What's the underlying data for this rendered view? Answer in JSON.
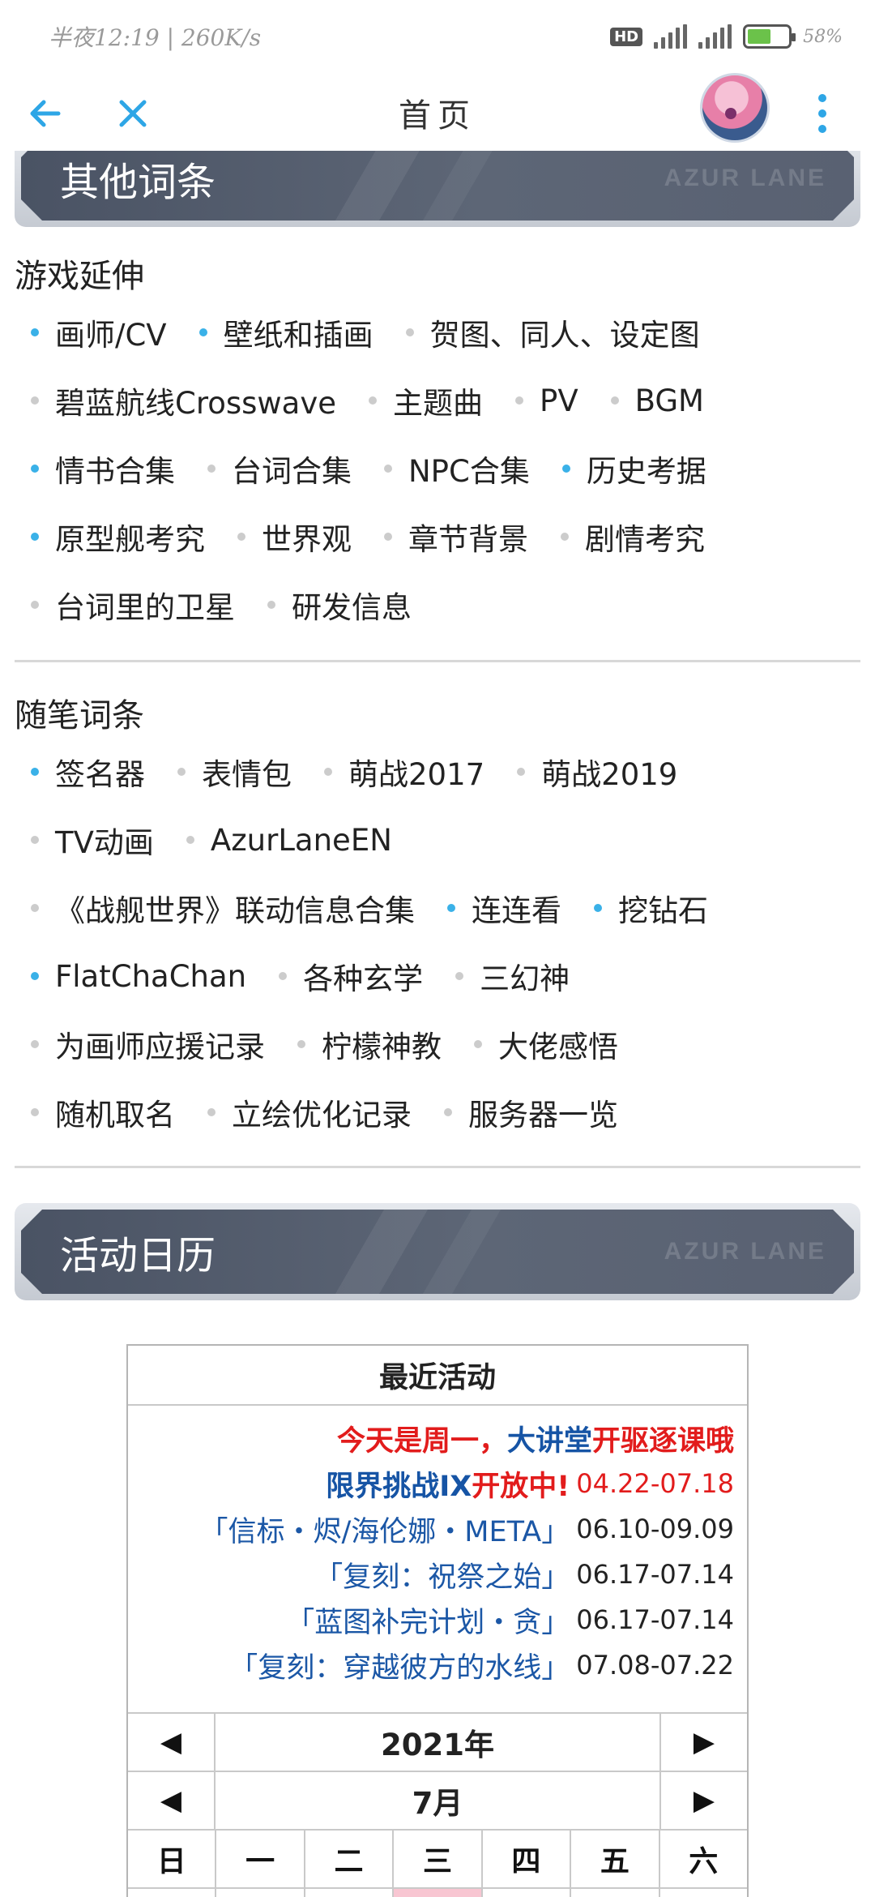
{
  "status_bar": {
    "left_text": "半夜12:19 | 260K/s",
    "hd_badge": "HD",
    "battery_percent": "58%"
  },
  "app_bar": {
    "title": "首页"
  },
  "banners": {
    "other_entries": "其他词条",
    "activity_calendar": "活动日历",
    "logo_text": "AZUR LANE"
  },
  "game_extension": {
    "heading": "游戏延伸",
    "rows": [
      [
        {
          "label": "画师/CV",
          "bullet": "blue"
        },
        {
          "label": "壁纸和插画",
          "bullet": "blue"
        },
        {
          "label": "贺图、同人、设定图",
          "bullet": "grey"
        }
      ],
      [
        {
          "label": "碧蓝航线Crosswave",
          "bullet": "grey"
        },
        {
          "label": "主题曲",
          "bullet": "grey"
        },
        {
          "label": "PV",
          "bullet": "grey"
        },
        {
          "label": "BGM",
          "bullet": "grey"
        }
      ],
      [
        {
          "label": "情书合集",
          "bullet": "blue"
        },
        {
          "label": "台词合集",
          "bullet": "grey"
        },
        {
          "label": "NPC合集",
          "bullet": "grey"
        },
        {
          "label": "历史考据",
          "bullet": "blue"
        }
      ],
      [
        {
          "label": "原型舰考究",
          "bullet": "blue"
        },
        {
          "label": "世界观",
          "bullet": "grey"
        },
        {
          "label": "章节背景",
          "bullet": "grey"
        },
        {
          "label": "剧情考究",
          "bullet": "grey"
        }
      ],
      [
        {
          "label": "台词里的卫星",
          "bullet": "grey"
        },
        {
          "label": "研发信息",
          "bullet": "grey"
        }
      ]
    ]
  },
  "essay_entries": {
    "heading": "随笔词条",
    "rows": [
      [
        {
          "label": "签名器",
          "bullet": "blue"
        },
        {
          "label": "表情包",
          "bullet": "grey"
        },
        {
          "label": "萌战2017",
          "bullet": "grey"
        },
        {
          "label": "萌战2019",
          "bullet": "grey"
        }
      ],
      [
        {
          "label": "TV动画",
          "bullet": "grey"
        },
        {
          "label": "AzurLaneEN",
          "bullet": "grey"
        }
      ],
      [
        {
          "label": "《战舰世界》联动信息合集",
          "bullet": "grey"
        },
        {
          "label": "连连看",
          "bullet": "blue"
        },
        {
          "label": "挖钻石",
          "bullet": "blue"
        }
      ],
      [
        {
          "label": "FlatChaChan",
          "bullet": "blue"
        },
        {
          "label": "各种玄学",
          "bullet": "grey"
        },
        {
          "label": "三幻神",
          "bullet": "grey"
        }
      ],
      [
        {
          "label": "为画师应援记录",
          "bullet": "grey"
        },
        {
          "label": "柠檬神教",
          "bullet": "grey"
        },
        {
          "label": "大佬感悟",
          "bullet": "grey"
        }
      ],
      [
        {
          "label": "随机取名",
          "bullet": "grey"
        },
        {
          "label": "立绘优化记录",
          "bullet": "grey"
        },
        {
          "label": "服务器一览",
          "bullet": "grey"
        }
      ]
    ]
  },
  "calendar": {
    "header": "最近活动",
    "notice": {
      "part1": "今天是周一，",
      "part2": "大讲堂",
      "part3": "开驱逐课哦"
    },
    "limit_challenge": {
      "name": "限界挑战IX",
      "status": "开放中!",
      "date": "04.22-07.18"
    },
    "events": [
      {
        "name": "「信标・烬/海伦娜・META」",
        "date": "06.10-09.09"
      },
      {
        "name": "「复刻：祝祭之始」",
        "date": "06.17-07.14"
      },
      {
        "name": "「蓝图补完计划・贪」",
        "date": "06.17-07.14"
      },
      {
        "name": "「复刻：穿越彼方的水线」",
        "date": "07.08-07.22"
      }
    ],
    "year_label": "2021年",
    "month_label": "7月",
    "prev_symbol": "◀",
    "next_symbol": "▶",
    "weekdays": [
      "日",
      "一",
      "二",
      "三",
      "四",
      "五",
      "六"
    ]
  },
  "colors": {
    "accent": "#2ea6e6",
    "bullet_blue": "#3ab1e8",
    "event_red": "#e21c1c",
    "event_blue": "#1654a5"
  }
}
